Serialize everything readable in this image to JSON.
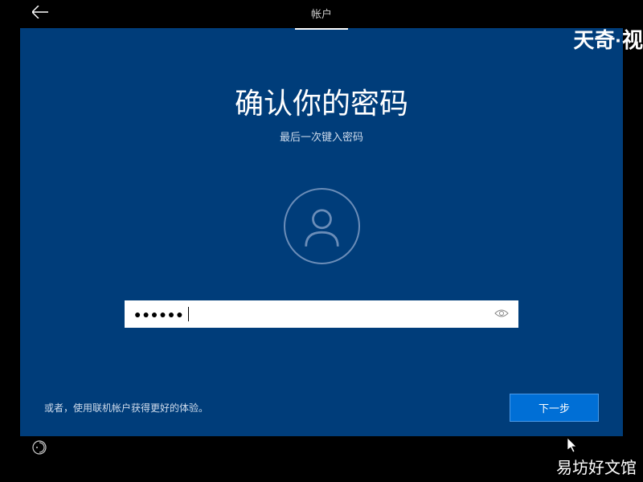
{
  "header": {
    "tab_label": "帐户"
  },
  "main": {
    "title": "确认你的密码",
    "subtitle": "最后一次键入密码"
  },
  "password": {
    "masked_value": "●●●●●●"
  },
  "bottom": {
    "alt_link": "或者，使用联机帐户获得更好的体验。",
    "next_button": "下一步"
  },
  "watermarks": {
    "top_right": "天奇·视",
    "bottom_right": "易坊好文馆"
  }
}
